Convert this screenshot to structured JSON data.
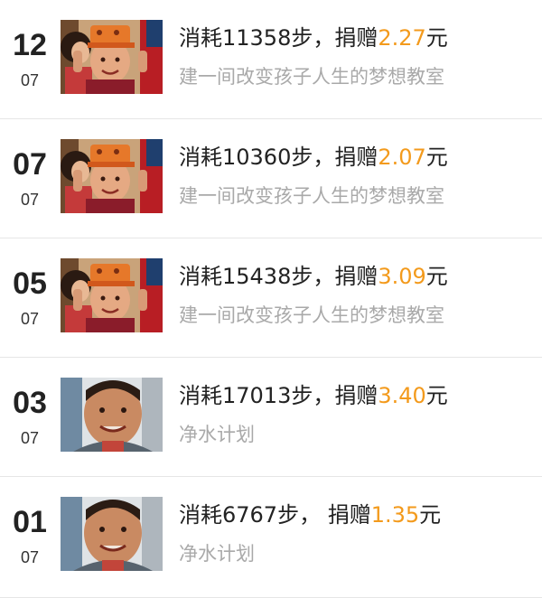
{
  "records": [
    {
      "day": "12",
      "month": "07",
      "title_prefix": "消耗11358步，捐赠",
      "amount": "2.27",
      "unit": "元",
      "project": "建一间改变孩子人生的梦想教室",
      "photo": "classroom"
    },
    {
      "day": "07",
      "month": "07",
      "title_prefix": "消耗10360步，捐赠",
      "amount": "2.07",
      "unit": "元",
      "project": "建一间改变孩子人生的梦想教室",
      "photo": "classroom"
    },
    {
      "day": "05",
      "month": "07",
      "title_prefix": "消耗15438步，捐赠",
      "amount": "3.09",
      "unit": "元",
      "project": "建一间改变孩子人生的梦想教室",
      "photo": "classroom"
    },
    {
      "day": "03",
      "month": "07",
      "title_prefix": "消耗17013步，捐赠",
      "amount": "3.40",
      "unit": "元",
      "project": "净水计划",
      "photo": "water"
    },
    {
      "day": "01",
      "month": "07",
      "title_prefix": "消耗6767步，  捐赠",
      "amount": "1.35",
      "unit": "元",
      "project": "净水计划",
      "photo": "water"
    }
  ],
  "colors": {
    "amount": "#f39a1c",
    "title": "#222222",
    "subtitle": "#a9a9a9",
    "divider": "#e6e6e6"
  }
}
